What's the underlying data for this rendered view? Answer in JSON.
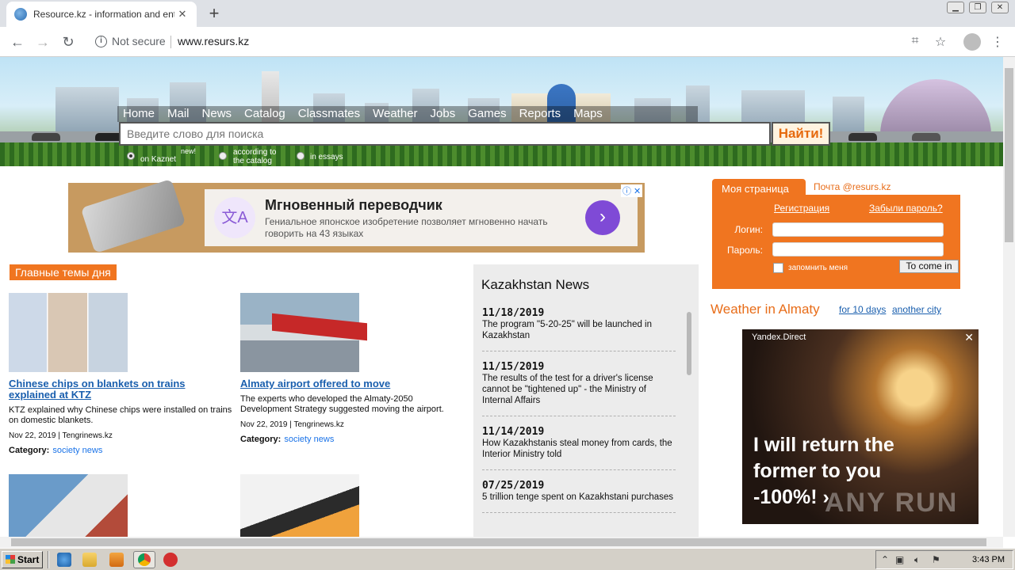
{
  "browser": {
    "tab_title": "Resource.kz - information and entertainment portal",
    "not_secure": "Not secure",
    "url": "www.resurs.kz"
  },
  "site": {
    "nav": [
      "Home",
      "Mail",
      "News",
      "Catalog",
      "Classmates",
      "Weather",
      "Jobs",
      "Games",
      "Reports",
      "Maps"
    ],
    "search": {
      "placeholder": "Введите слово для поиска",
      "button": "Найти!"
    },
    "search_options": [
      {
        "label": "on Kaznet",
        "badge": "new!",
        "selected": true
      },
      {
        "label": "according to the catalog",
        "selected": false
      },
      {
        "label": "in essays",
        "selected": false
      }
    ]
  },
  "ad": {
    "title": "Мгновенный переводчик",
    "subtitle": "Гениальное японское изобретение позволяет мгновенно начать говорить на 43 языках",
    "go": "›",
    "marks": "ⓘ ✕"
  },
  "topics": {
    "header": "Главные темы дня",
    "category_label": "Category:",
    "stories": [
      {
        "title": "Chinese chips on blankets on trains explained at KTZ",
        "desc": "KTZ explained why Chinese chips were installed on trains on domestic blankets.",
        "meta": "Nov 22, 2019 | Tengrinews.kz",
        "category": "society news"
      },
      {
        "title": "Almaty airport offered to move",
        "desc": "The experts who developed the Almaty-2050 Development Strategy suggested moving the airport.",
        "meta": "Nov 22, 2019 | Tengrinews.kz",
        "category": "society news"
      }
    ]
  },
  "kz_news": {
    "title": "Kazakhstan News",
    "items": [
      {
        "date": "11/18/2019",
        "text": "The program \"5-20-25\" will be launched in Kazakhstan"
      },
      {
        "date": "11/15/2019",
        "text": "The results of the test for a driver's license cannot be \"tightened up\" - the Ministry of Internal Affairs"
      },
      {
        "date": "11/14/2019",
        "text": "How Kazakhstanis steal money from cards, the Interior Ministry told"
      },
      {
        "date": "07/25/2019",
        "text": "5 trillion tenge spent on Kazakhstani purchases"
      }
    ]
  },
  "my_page": {
    "tab": "Моя страница",
    "mail": "Почта @resurs.kz",
    "register": "Регистрация",
    "forgot": "Забыли пароль?",
    "login_label": "Логин:",
    "password_label": "Пароль:",
    "remember": "запомнить меня",
    "submit": "To come in"
  },
  "weather": {
    "title": "Weather in Almaty",
    "link_days": "for 10 days",
    "link_city": "another city"
  },
  "yandex_ad": {
    "label": "Yandex.Direct",
    "text": "I will return the former to you -100%! ›",
    "watermark": "ANY RUN"
  },
  "taskbar": {
    "start": "Start",
    "clock": "3:43 PM"
  },
  "colors": {
    "accent_orange": "#f07520",
    "link_blue": "#1a5fae"
  }
}
